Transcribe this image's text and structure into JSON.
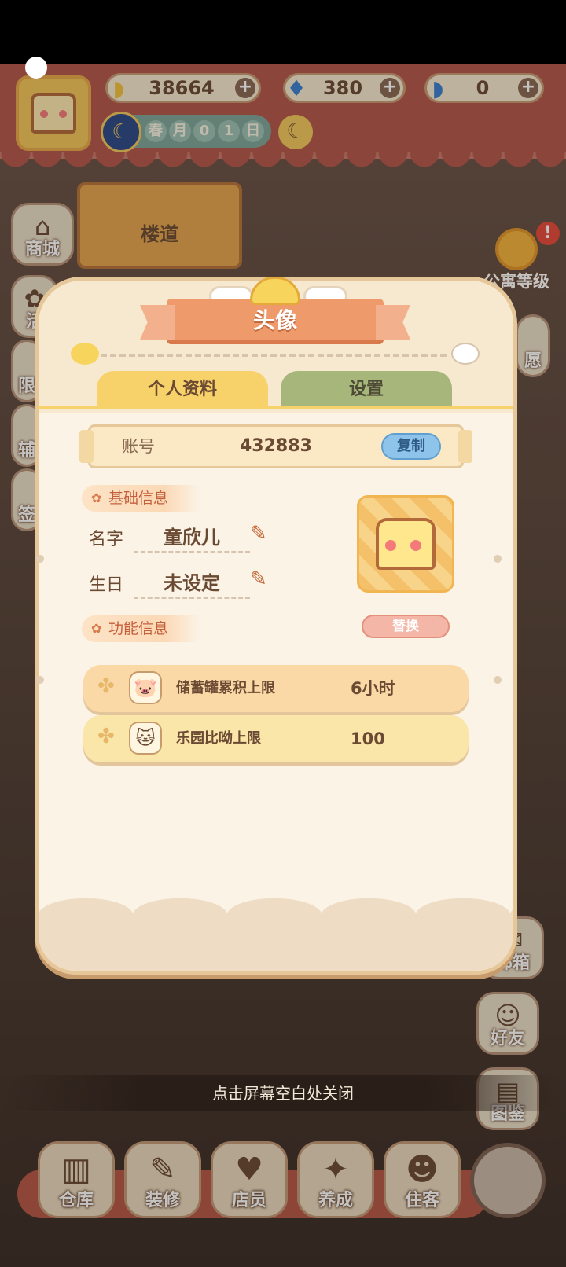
{
  "hud": {
    "resources": [
      {
        "icon": "banana-icon",
        "value": "38664"
      },
      {
        "icon": "blue-flame-icon",
        "value": "380"
      },
      {
        "icon": "blue-banana-icon",
        "value": "0"
      }
    ],
    "date_chars": [
      "春",
      "月",
      "0",
      "1",
      "日"
    ]
  },
  "scene": {
    "stair_label": "楼道",
    "apartment_level_label": "公寓等级",
    "apartment_level_badge": "!",
    "close_hint": "点击屏幕空白处关闭"
  },
  "side_left": [
    {
      "label": "商城",
      "icon": "shop-icon"
    },
    {
      "label": "活",
      "icon": "event-icon"
    },
    {
      "label": "限",
      "icon": "limited-icon"
    },
    {
      "label": "辅",
      "icon": "helper-icon"
    },
    {
      "label": "签",
      "icon": "signin-icon"
    }
  ],
  "side_right": [
    {
      "label": "愿",
      "icon": "wish-icon"
    },
    {
      "label": "邮箱",
      "icon": "mailbox-icon"
    },
    {
      "label": "好友",
      "icon": "friends-icon"
    },
    {
      "label": "图鉴",
      "icon": "catalog-icon"
    }
  ],
  "bottom_nav": [
    {
      "label": "仓库",
      "icon": "warehouse-icon"
    },
    {
      "label": "装修",
      "icon": "decorate-icon"
    },
    {
      "label": "店员",
      "icon": "staff-icon"
    },
    {
      "label": "养成",
      "icon": "growth-icon"
    },
    {
      "label": "住客",
      "icon": "tenant-icon"
    }
  ],
  "dialog": {
    "title": "头像",
    "tabs": {
      "profile": "个人资料",
      "settings": "设置"
    },
    "account": {
      "label": "账号",
      "value": "432883",
      "copy": "复制"
    },
    "basic_section": "基础信息",
    "name": {
      "label": "名字",
      "value": "童欣儿"
    },
    "birthday": {
      "label": "生日",
      "value": "未设定"
    },
    "feature_section": "功能信息",
    "replace": "替换",
    "features": [
      {
        "name": "储蓄罐累积上限",
        "value": "6小时",
        "icon": "piggy-bank-icon"
      },
      {
        "name": "乐园比呦上限",
        "value": "100",
        "icon": "cat-group-icon"
      }
    ]
  },
  "colors": {
    "accent": "#ee9a6a",
    "tab_profile": "#f7d169",
    "tab_settings": "#a7b67b",
    "copy_button": "#8fc4ea"
  }
}
